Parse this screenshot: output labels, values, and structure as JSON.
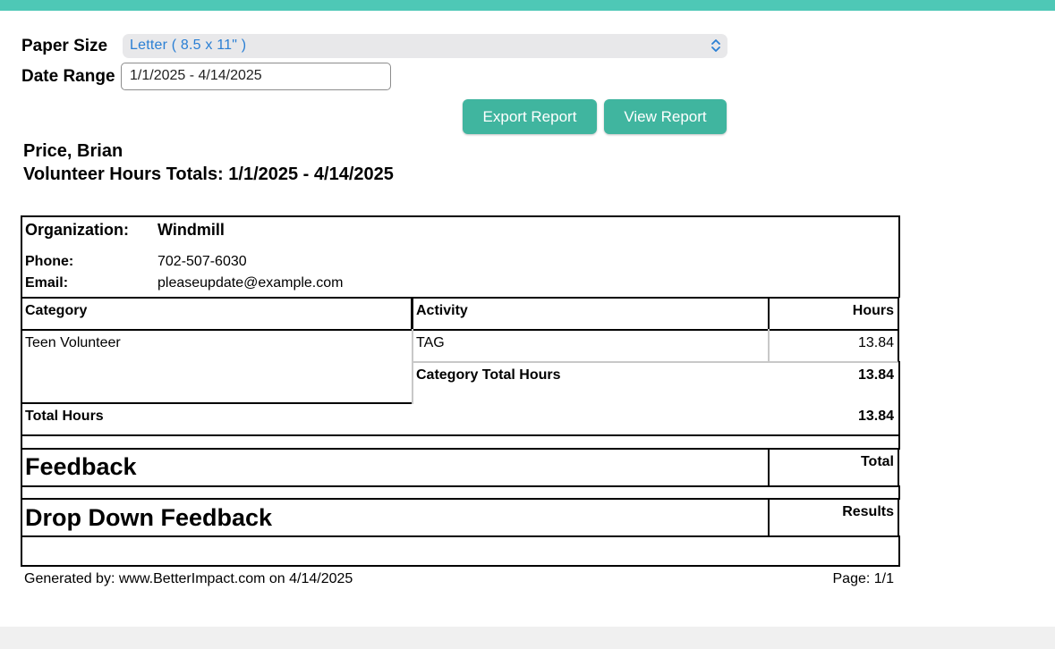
{
  "controls": {
    "paper_size_label": "Paper Size",
    "paper_size_value": "Letter ( 8.5 x 11\" )",
    "date_range_label": "Date Range",
    "date_range_value": "1/1/2025 - 4/14/2025",
    "export_label": "Export Report",
    "view_label": "View Report"
  },
  "report": {
    "volunteer_name": "Price, Brian",
    "title": "Volunteer Hours Totals: 1/1/2025 - 4/14/2025",
    "org_label": "Organization:",
    "org_value": "Windmill",
    "phone_label": "Phone:",
    "phone_value": "702-507-6030",
    "email_label": "Email:",
    "email_value": "pleaseupdate@example.com",
    "columns": {
      "category": "Category",
      "activity": "Activity",
      "hours": "Hours"
    },
    "rows": [
      {
        "category": "Teen Volunteer",
        "activity": "TAG",
        "hours": "13.84"
      }
    ],
    "category_total_label": "Category Total Hours",
    "category_total_value": "13.84",
    "total_hours_label": "Total Hours",
    "total_hours_value": "13.84",
    "feedback_label": "Feedback",
    "feedback_total_label": "Total",
    "dropdown_feedback_label": "Drop Down Feedback",
    "dropdown_results_label": "Results"
  },
  "footer": {
    "generated": "Generated by: www.BetterImpact.com on 4/14/2025",
    "page": "Page: 1/1"
  },
  "colors": {
    "accent": "#4ec8b6",
    "button": "#40b59f",
    "select_text": "#2a7fd4"
  },
  "icons": {
    "select_chevron": "chevron-up-down-icon"
  }
}
